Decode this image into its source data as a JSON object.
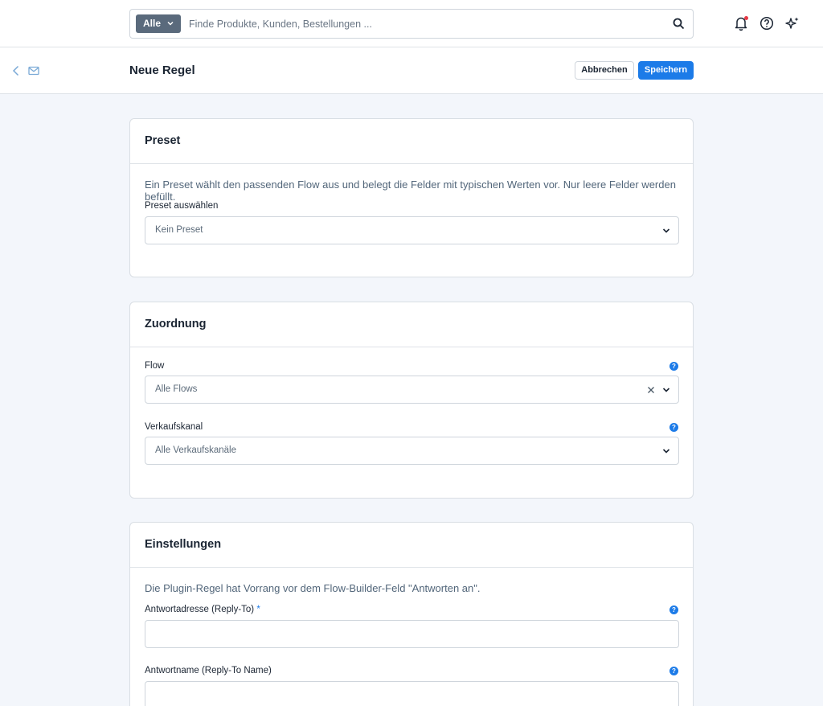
{
  "header": {
    "search_scope": "Alle",
    "search_placeholder": "Finde Produkte, Kunden, Bestellungen ...",
    "icons": [
      "chevron-down-icon",
      "search-icon",
      "bell-icon",
      "help-circle-icon",
      "sparkle-icon"
    ]
  },
  "subheader": {
    "title": "Neue Regel",
    "cancel_label": "Abbrechen",
    "save_label": "Speichern"
  },
  "preset": {
    "title": "Preset",
    "description": "Ein Preset wählt den passenden Flow aus und belegt die Felder mit typischen Werten vor. Nur leere Felder werden befüllt.",
    "label": "Preset auswählen",
    "value": "Kein Preset"
  },
  "mapping": {
    "title": "Zuordnung",
    "flow_label": "Flow",
    "flow_value": "Alle Flows",
    "channel_label": "Verkaufskanal",
    "channel_value": "Alle Verkaufskanäle"
  },
  "settings": {
    "title": "Einstellungen",
    "description": "Die Plugin-Regel hat Vorrang vor dem Flow-Builder-Feld \"Antworten an\".",
    "reply_to_label": "Antwortadresse (Reply-To)",
    "required_mark": "*",
    "reply_to_value": "",
    "reply_name_label": "Antwortname (Reply-To Name)",
    "reply_name_value": ""
  },
  "help_mark": "?",
  "colors": {
    "primary": "#1c7be8",
    "scope_badge": "#5a6a7c",
    "notification_dot": "#e63946",
    "background": "#f3f6fb"
  }
}
